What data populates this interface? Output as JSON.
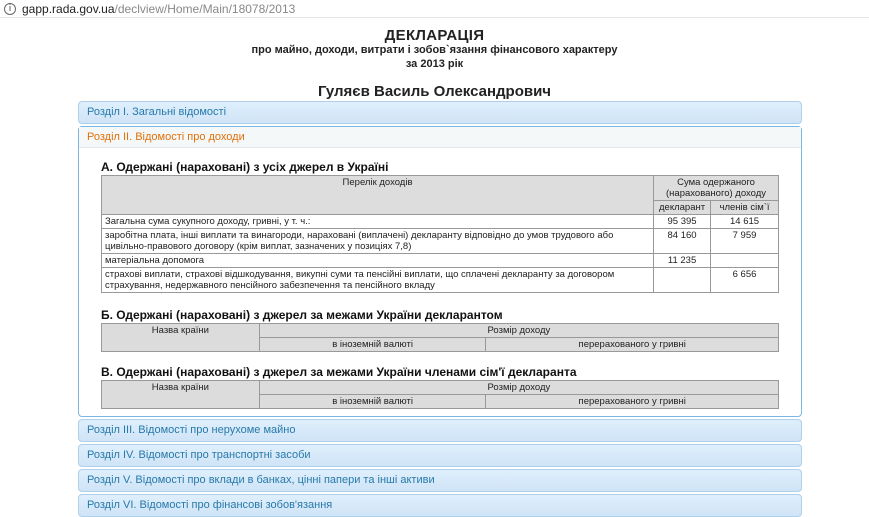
{
  "browser": {
    "url_host": "gapp.rada.gov.ua",
    "url_path": "/declview/Home/Main/18078/2013"
  },
  "header": {
    "title": "ДЕКЛАРАЦІЯ",
    "subtitle1": "про майно, доходи, витрати і зобов`язання фінансового характеру",
    "subtitle2": "за 2013 рік",
    "person_name": "Гуляєв Василь Олександрович"
  },
  "sections": {
    "s1": "Розділ I. Загальні відомості",
    "s2": "Розділ II. Відомості про доходи",
    "s3": "Розділ III. Відомості про нерухоме майно",
    "s4": "Розділ IV. Відомості про транспортні засоби",
    "s5": "Розділ V. Відомості про вклади в банках, цінні папери та інші активи",
    "s6": "Розділ VI. Відомості про фінансові зобов'язання"
  },
  "income": {
    "a_title": "А. Одержані (нараховані) з усіх джерел в Україні",
    "col_list": "Перелік доходів",
    "col_sum": "Сума одержаного (нарахованого) доходу",
    "col_declarant": "декларант",
    "col_family": "членів сім`ї",
    "rows": [
      {
        "label": "Загальна сума сукупного доходу, гривні, у т. ч.:",
        "declarant": "95 395",
        "family": "14 615"
      },
      {
        "label": "заробітна плата, інші виплати та винагороди, нараховані (виплачені) декларанту відповідно до умов трудового або цивільно-правового договору (крім виплат, зазначених у позиціях 7,8)",
        "declarant": "84 160",
        "family": "7 959"
      },
      {
        "label": "матеріальна допомога",
        "declarant": "11 235",
        "family": ""
      },
      {
        "label": "страхові виплати, страхові відшкодування, викупні суми та пенсійні виплати, що сплачені декларанту за договором страхування, недержавного пенсійного забезпечення та пенсійного вкладу",
        "declarant": "",
        "family": "6 656"
      }
    ],
    "b_title": "Б. Одержані (нараховані) з джерел за межами України декларантом",
    "c_title": "В. Одержані (нараховані) з джерел за межами України членами сім'ї декларанта",
    "col_country": "Назва країни",
    "col_amount": "Розмір доходу",
    "col_foreign": "в іноземній валюті",
    "col_uah": "перерахованого у гривні"
  }
}
